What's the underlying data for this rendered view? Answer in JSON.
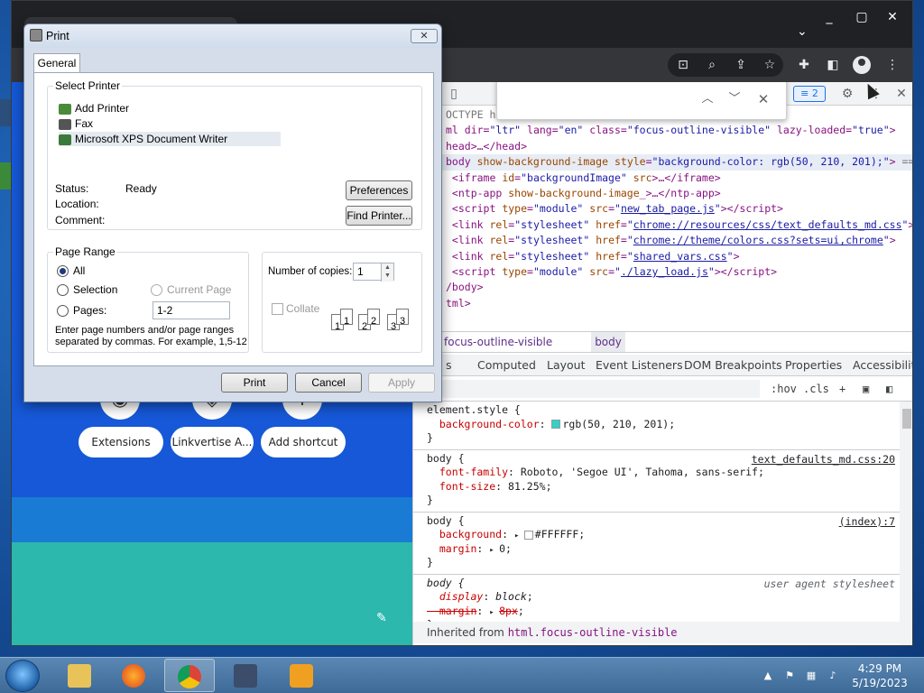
{
  "devtools": {
    "code_lines": [
      {
        "html": "<span class=\"grey\">OCTYPE h</span>"
      },
      {
        "html": "ml dir=<span class=\"val\">\"ltr\"</span> lang=<span class=\"val\">\"en\"</span> class=<span class=\"val\">\"focus-outline-visible\"</span> lazy-loaded=<span class=\"val\">\"true\"</span>&gt;"
      },
      {
        "html": "head&gt;…&lt;/head&gt;"
      },
      {
        "html": "body <span class=\"attr\">show-background-image</span> <span class=\"attr\">style</span>=<span class=\"val\">\"background-color: rgb(50, 210, 201);\"</span>&gt; <span class=\"grey\">== $0</span>",
        "selected": true
      },
      {
        "html": " &lt;iframe <span class=\"attr\">id</span>=<span class=\"val\">\"backgroundImage\"</span> <span class=\"attr\">src</span>&gt;…&lt;/iframe&gt;"
      },
      {
        "html": " &lt;ntp-app <span class=\"attr\">show-background-image</span>_&gt;…&lt;/ntp-app&gt;"
      },
      {
        "html": " &lt;script <span class=\"attr\">type</span>=<span class=\"val\">\"module\"</span> <span class=\"attr\">src</span>=<span class=\"val\">\"<span class=\"lnk\">new_tab_page.js</span>\"</span>&gt;&lt;/script&gt;"
      },
      {
        "html": " &lt;link <span class=\"attr\">rel</span>=<span class=\"val\">\"stylesheet\"</span> <span class=\"attr\">href</span>=<span class=\"val\">\"<span class=\"lnk\">chrome://resources/css/text_defaults_md.css</span>\"</span>&gt;"
      },
      {
        "html": " &lt;link <span class=\"attr\">rel</span>=<span class=\"val\">\"stylesheet\"</span> <span class=\"attr\">href</span>=<span class=\"val\">\"<span class=\"lnk\">chrome://theme/colors.css?sets=ui,chrome</span>\"</span>&gt;"
      },
      {
        "html": " &lt;link <span class=\"attr\">rel</span>=<span class=\"val\">\"stylesheet\"</span> <span class=\"attr\">href</span>=<span class=\"val\">\"<span class=\"lnk\">shared_vars.css</span>\"</span>&gt;"
      },
      {
        "html": " &lt;script <span class=\"attr\">type</span>=<span class=\"val\">\"module\"</span> <span class=\"attr\">src</span>=<span class=\"val\">\"<span class=\"lnk\">./lazy_load.js</span>\"</span>&gt;&lt;/script&gt;"
      },
      {
        "html": "/body&gt;"
      },
      {
        "html": "tml&gt;"
      }
    ],
    "badge": "2",
    "crumbs": [
      "focus-outline-visible",
      "body"
    ],
    "subtabs": [
      "s",
      "Computed",
      "Layout",
      "Event Listeners",
      "DOM Breakpoints",
      "Properties",
      "Accessibility"
    ],
    "filter_tools": [
      ":hov",
      ".cls",
      "+"
    ],
    "rules": [
      {
        "selector": "element.style {",
        "decls": [
          {
            "prop": "background-color",
            "value": "rgb(50, 210, 201)",
            "swatch": "#32d2c9"
          }
        ],
        "source": ""
      },
      {
        "selector": "body {",
        "decls": [
          {
            "prop": "font-family",
            "value": "Roboto, 'Segoe UI', Tahoma, sans-serif"
          },
          {
            "prop": "font-size",
            "value": "81.25%"
          }
        ],
        "source": "text_defaults_md.css:20"
      },
      {
        "selector": "body {",
        "decls": [
          {
            "prop": "background",
            "value": "#FFFFFF",
            "swatch": "#FFFFFF",
            "arrow": true
          },
          {
            "prop": "margin",
            "value": "0",
            "arrow": true
          }
        ],
        "source": "(index):7"
      },
      {
        "selector": "body {",
        "decls": [
          {
            "prop": "display",
            "value": "block",
            "italic": true
          },
          {
            "prop": "margin",
            "value": "8px",
            "strike": true,
            "arrow": true
          }
        ],
        "source": "user agent stylesheet",
        "ua": true
      }
    ],
    "inherited_label": "Inherited from",
    "inherited_class": "html.focus-outline-visible"
  },
  "page": {
    "shortcuts": [
      "Extensions",
      "Linkvertise A...",
      "Add shortcut"
    ],
    "shortcut_icons": [
      "chrome-icon",
      "linkvertise-icon",
      "plus-icon"
    ]
  },
  "print_dialog": {
    "title": "Print",
    "tab": "General",
    "select_printer_label": "Select Printer",
    "printers": [
      "Add Printer",
      "Fax",
      "Microsoft XPS Document Writer"
    ],
    "selected_printer_index": 2,
    "status_label": "Status:",
    "status_value": "Ready",
    "location_label": "Location:",
    "comment_label": "Comment:",
    "preferences_button": "Preferences",
    "find_printer_button": "Find Printer...",
    "page_range_label": "Page Range",
    "range_all": "All",
    "range_selection": "Selection",
    "range_current_page": "Current Page",
    "range_pages": "Pages:",
    "pages_value": "1-2",
    "range_hint": "Enter page numbers and/or page ranges separated by commas.  For example, 1,5-12",
    "copies_label": "Number of copies:",
    "copies_value": "1",
    "collate_label": "Collate",
    "print_button": "Print",
    "cancel_button": "Cancel",
    "apply_button": "Apply"
  },
  "taskbar": {
    "time": "4:29 PM",
    "date": "5/19/2023",
    "apps": [
      "explorer",
      "firefox",
      "chrome",
      "media-player",
      "video-app"
    ]
  },
  "colors": {
    "page_bg": "#1658d8",
    "accent_teal": "#32d2c9",
    "taskbar": "#3d6a97"
  }
}
